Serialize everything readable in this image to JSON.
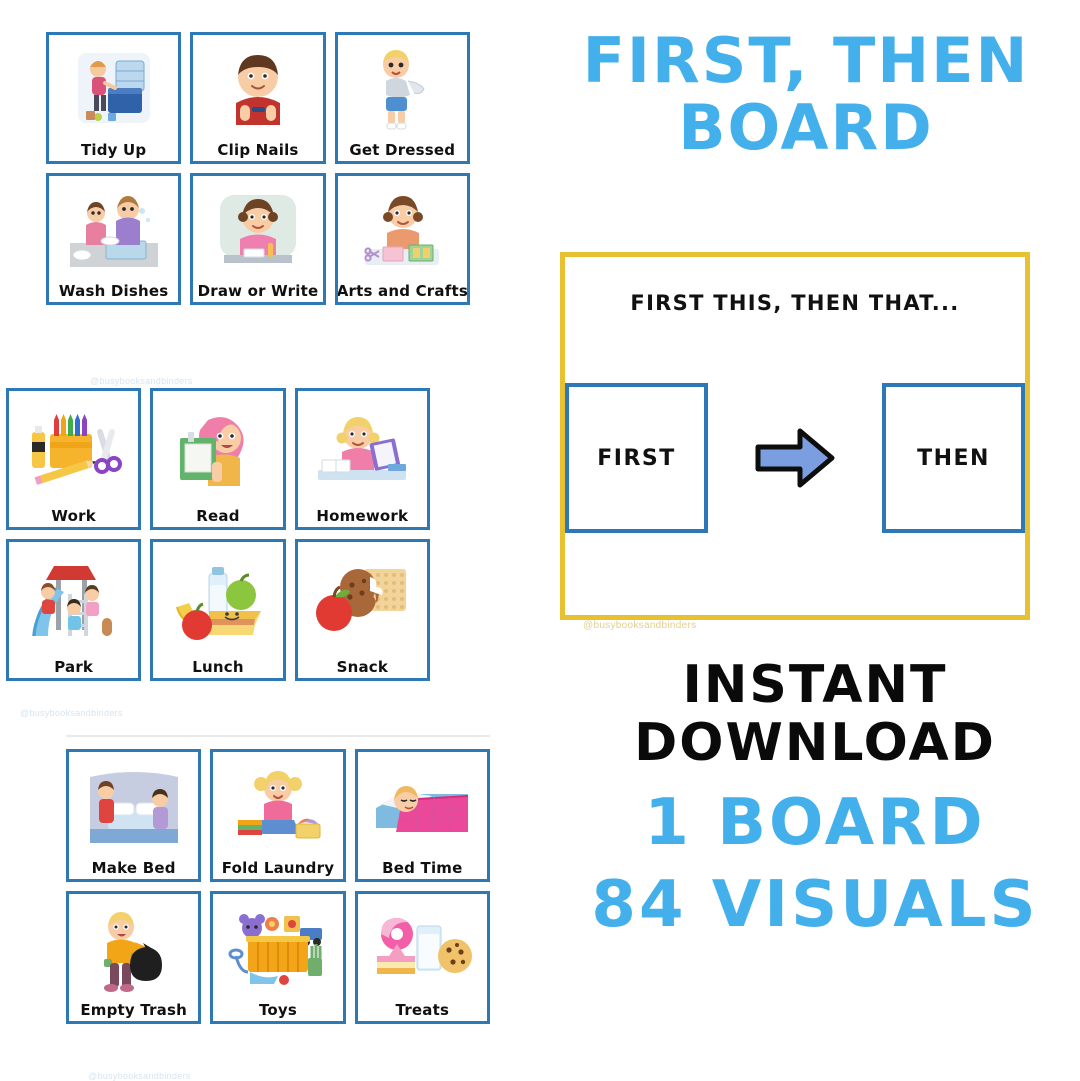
{
  "headline": {
    "line1": "FIRST, THEN",
    "line2": "BOARD"
  },
  "colors": {
    "accent_blue": "#43b0ec",
    "card_border_blue": "#2c79b5",
    "board_border_yellow": "#e7c12f",
    "slot_border_blue": "#2e78b8",
    "arrow_blue": "#7b9ee0",
    "text_black": "#0a0a0a"
  },
  "board": {
    "heading": "FIRST THIS, THEN THAT...",
    "first_slot_label": "FIRST",
    "then_slot_label": "THEN",
    "arrow_icon": "right-arrow-icon",
    "watermark": "@busybooksandbinders"
  },
  "promo": {
    "line1": "INSTANT",
    "line2": "DOWNLOAD",
    "line3": "1 BOARD",
    "line4": "84 VISUALS"
  },
  "sheets": [
    {
      "id": "chores",
      "watermark": "@busybooksandbinders",
      "cards": [
        {
          "label": "Tidy Up",
          "art": "child-tidying-toy-box"
        },
        {
          "label": "Clip Nails",
          "art": "boy-clipping-nails"
        },
        {
          "label": "Get Dressed",
          "art": "boy-putting-on-shirt"
        },
        {
          "label": "Wash Dishes",
          "art": "parent-and-child-washing-dishes"
        },
        {
          "label": "Draw or Write",
          "art": "girl-drawing-at-desk"
        },
        {
          "label": "Arts and Crafts",
          "art": "girl-doing-crafts"
        }
      ]
    },
    {
      "id": "activities",
      "watermark": "@busybooksandbinders",
      "cards": [
        {
          "label": "Work",
          "art": "crayons-scissors-pencil-glue"
        },
        {
          "label": "Read",
          "art": "girl-holding-book"
        },
        {
          "label": "Homework",
          "art": "girl-reading-at-desk"
        },
        {
          "label": "Park",
          "art": "children-on-playground-slide"
        },
        {
          "label": "Lunch",
          "art": "sandwich-milk-banana-apple"
        },
        {
          "label": "Snack",
          "art": "apple-cookie-cracker"
        }
      ]
    },
    {
      "id": "home",
      "watermark": "@busybooksandbinders",
      "cards": [
        {
          "label": "Make Bed",
          "art": "children-making-bed"
        },
        {
          "label": "Fold Laundry",
          "art": "girl-folding-laundry"
        },
        {
          "label": "Bed Time",
          "art": "child-sleeping-in-bed"
        },
        {
          "label": "Empty Trash",
          "art": "boy-holding-trash-bag"
        },
        {
          "label": "Toys",
          "art": "toy-box-with-toys"
        },
        {
          "label": "Treats",
          "art": "cake-milk-donut-cookie"
        }
      ]
    }
  ]
}
